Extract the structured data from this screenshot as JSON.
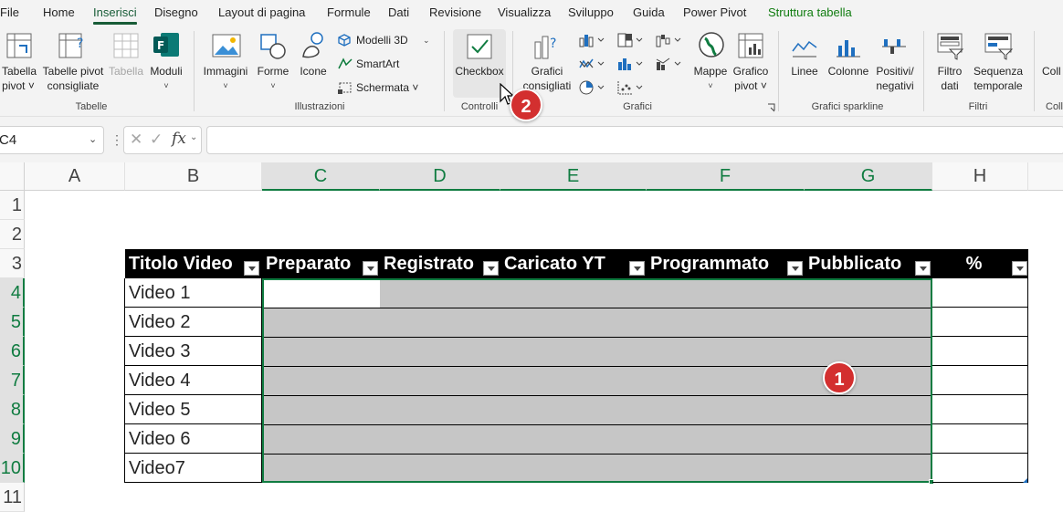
{
  "menu": {
    "items": [
      "File",
      "Home",
      "Inserisci",
      "Disegno",
      "Layout di pagina",
      "Formule",
      "Dati",
      "Revisione",
      "Visualizza",
      "Sviluppo",
      "Guida",
      "Power Pivot",
      "Struttura tabella"
    ],
    "active": "Inserisci"
  },
  "ribbon": {
    "tabelle": {
      "tabella_pivot": [
        "Tabella",
        "pivot ˅"
      ],
      "tabelle_pivot_consigliate": [
        "Tabelle pivot",
        "consigliate"
      ],
      "tabella": "Tabella",
      "moduli": [
        "Moduli",
        "˅"
      ],
      "label": "Tabelle"
    },
    "illustrazioni": {
      "immagini": [
        "Immagini",
        "˅"
      ],
      "forme": [
        "Forme",
        "˅"
      ],
      "icone": "Icone",
      "modelli3d": "Modelli 3D",
      "smartart": "SmartArt",
      "schermata": "Schermata ˅",
      "label": "Illustrazioni"
    },
    "controlli": {
      "checkbox": "Checkbox",
      "label": "Controlli"
    },
    "grafici": {
      "consigliati": [
        "Grafici",
        "consigliati"
      ],
      "mappe": [
        "Mappe",
        "˅"
      ],
      "grafico_pivot": [
        "Grafico",
        "pivot ˅"
      ],
      "label": "Grafici"
    },
    "sparkline": {
      "linee": "Linee",
      "colonne": "Colonne",
      "positivi": [
        "Positivi/",
        "negativi"
      ],
      "label": "Grafici sparkline"
    },
    "filtri": {
      "filtro_dati": [
        "Filtro",
        "dati"
      ],
      "sequenza": [
        "Sequenza",
        "temporale"
      ],
      "label": "Filtri"
    },
    "collegamenti": {
      "partial_label": "Coll",
      "partial_button": "Coll"
    }
  },
  "formula_bar": {
    "name_box": "C4",
    "fx": "fx",
    "formula": ""
  },
  "columns": [
    "A",
    "B",
    "C",
    "D",
    "E",
    "F",
    "G",
    "H"
  ],
  "rows": [
    "1",
    "2",
    "3",
    "4",
    "5",
    "6",
    "7",
    "8",
    "9",
    "10",
    "11"
  ],
  "table": {
    "headers": [
      "Titolo Video",
      "Preparato",
      "Registrato",
      "Caricato YT",
      "Programmato",
      "Pubblicato",
      "%"
    ],
    "rows": [
      "Video 1",
      "Video 2",
      "Video 3",
      "Video 4",
      "Video 5",
      "Video 6",
      "Video7"
    ]
  },
  "annotations": {
    "badge1": "1",
    "badge2": "2"
  },
  "colors": {
    "excel_green": "#107c41",
    "selection_gray": "#c6c6c6",
    "badge_red": "#d32f2f",
    "header_black": "#000000"
  }
}
